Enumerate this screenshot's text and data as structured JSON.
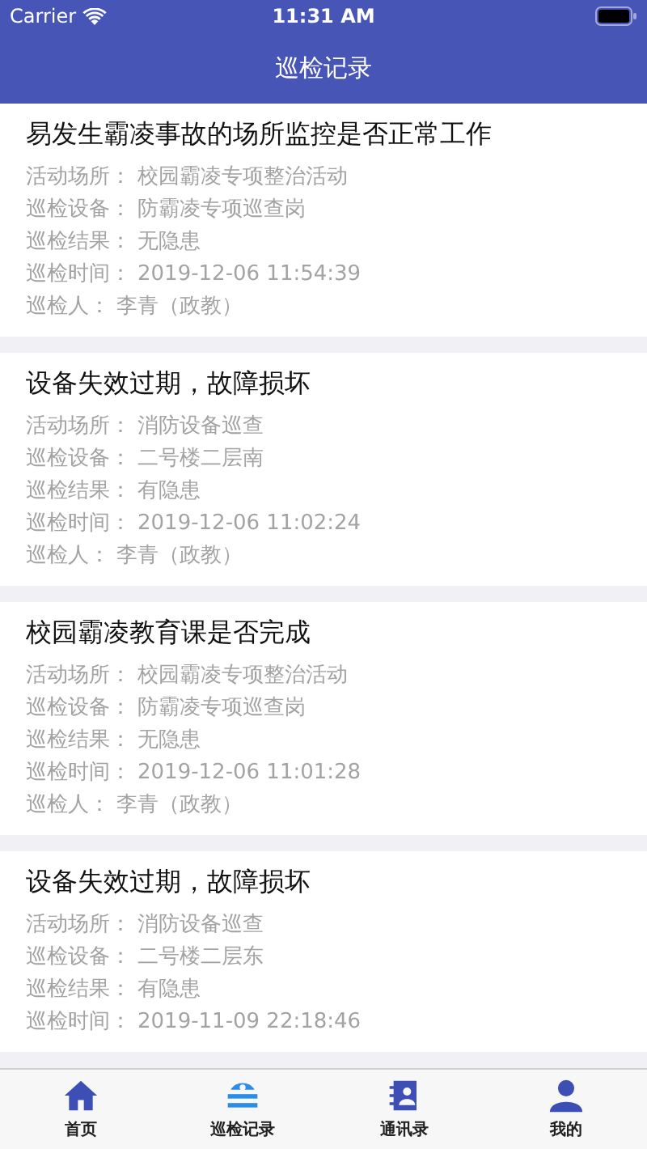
{
  "status_bar": {
    "carrier": "Carrier",
    "time": "11:31 AM"
  },
  "nav": {
    "title": "巡检记录"
  },
  "records": [
    {
      "title": "易发生霸凌事故的场所监控是否正常工作",
      "fields": [
        {
          "label": "活动场所：",
          "value": "校园霸凌专项整治活动"
        },
        {
          "label": "巡检设备：",
          "value": "防霸凌专项巡查岗"
        },
        {
          "label": "巡检结果：",
          "value": "无隐患"
        },
        {
          "label": "巡检时间：",
          "value": "2019-12-06 11:54:39"
        },
        {
          "label": "巡检人：",
          "value": "李青（政教）"
        }
      ]
    },
    {
      "title": "设备失效过期，故障损坏",
      "fields": [
        {
          "label": "活动场所：",
          "value": "消防设备巡查"
        },
        {
          "label": "巡检设备：",
          "value": "二号楼二层南"
        },
        {
          "label": "巡检结果：",
          "value": "有隐患"
        },
        {
          "label": "巡检时间：",
          "value": "2019-12-06 11:02:24"
        },
        {
          "label": "巡检人：",
          "value": "李青（政教）"
        }
      ]
    },
    {
      "title": "校园霸凌教育课是否完成",
      "fields": [
        {
          "label": "活动场所：",
          "value": "校园霸凌专项整治活动"
        },
        {
          "label": "巡检设备：",
          "value": "防霸凌专项巡查岗"
        },
        {
          "label": "巡检结果：",
          "value": "无隐患"
        },
        {
          "label": "巡检时间：",
          "value": "2019-12-06 11:01:28"
        },
        {
          "label": "巡检人：",
          "value": "李青（政教）"
        }
      ]
    },
    {
      "title": "设备失效过期，故障损坏",
      "fields": [
        {
          "label": "活动场所：",
          "value": "消防设备巡查"
        },
        {
          "label": "巡检设备：",
          "value": "二号楼二层东"
        },
        {
          "label": "巡检结果：",
          "value": "有隐患"
        },
        {
          "label": "巡检时间：",
          "value": "2019-11-09 22:18:46"
        }
      ]
    }
  ],
  "tab_bar": [
    {
      "kind": "home",
      "label": "首页",
      "selected": false
    },
    {
      "kind": "records",
      "label": "巡检记录",
      "selected": true
    },
    {
      "kind": "contacts",
      "label": "通讯录",
      "selected": false
    },
    {
      "kind": "profile",
      "label": "我的",
      "selected": false
    }
  ]
}
